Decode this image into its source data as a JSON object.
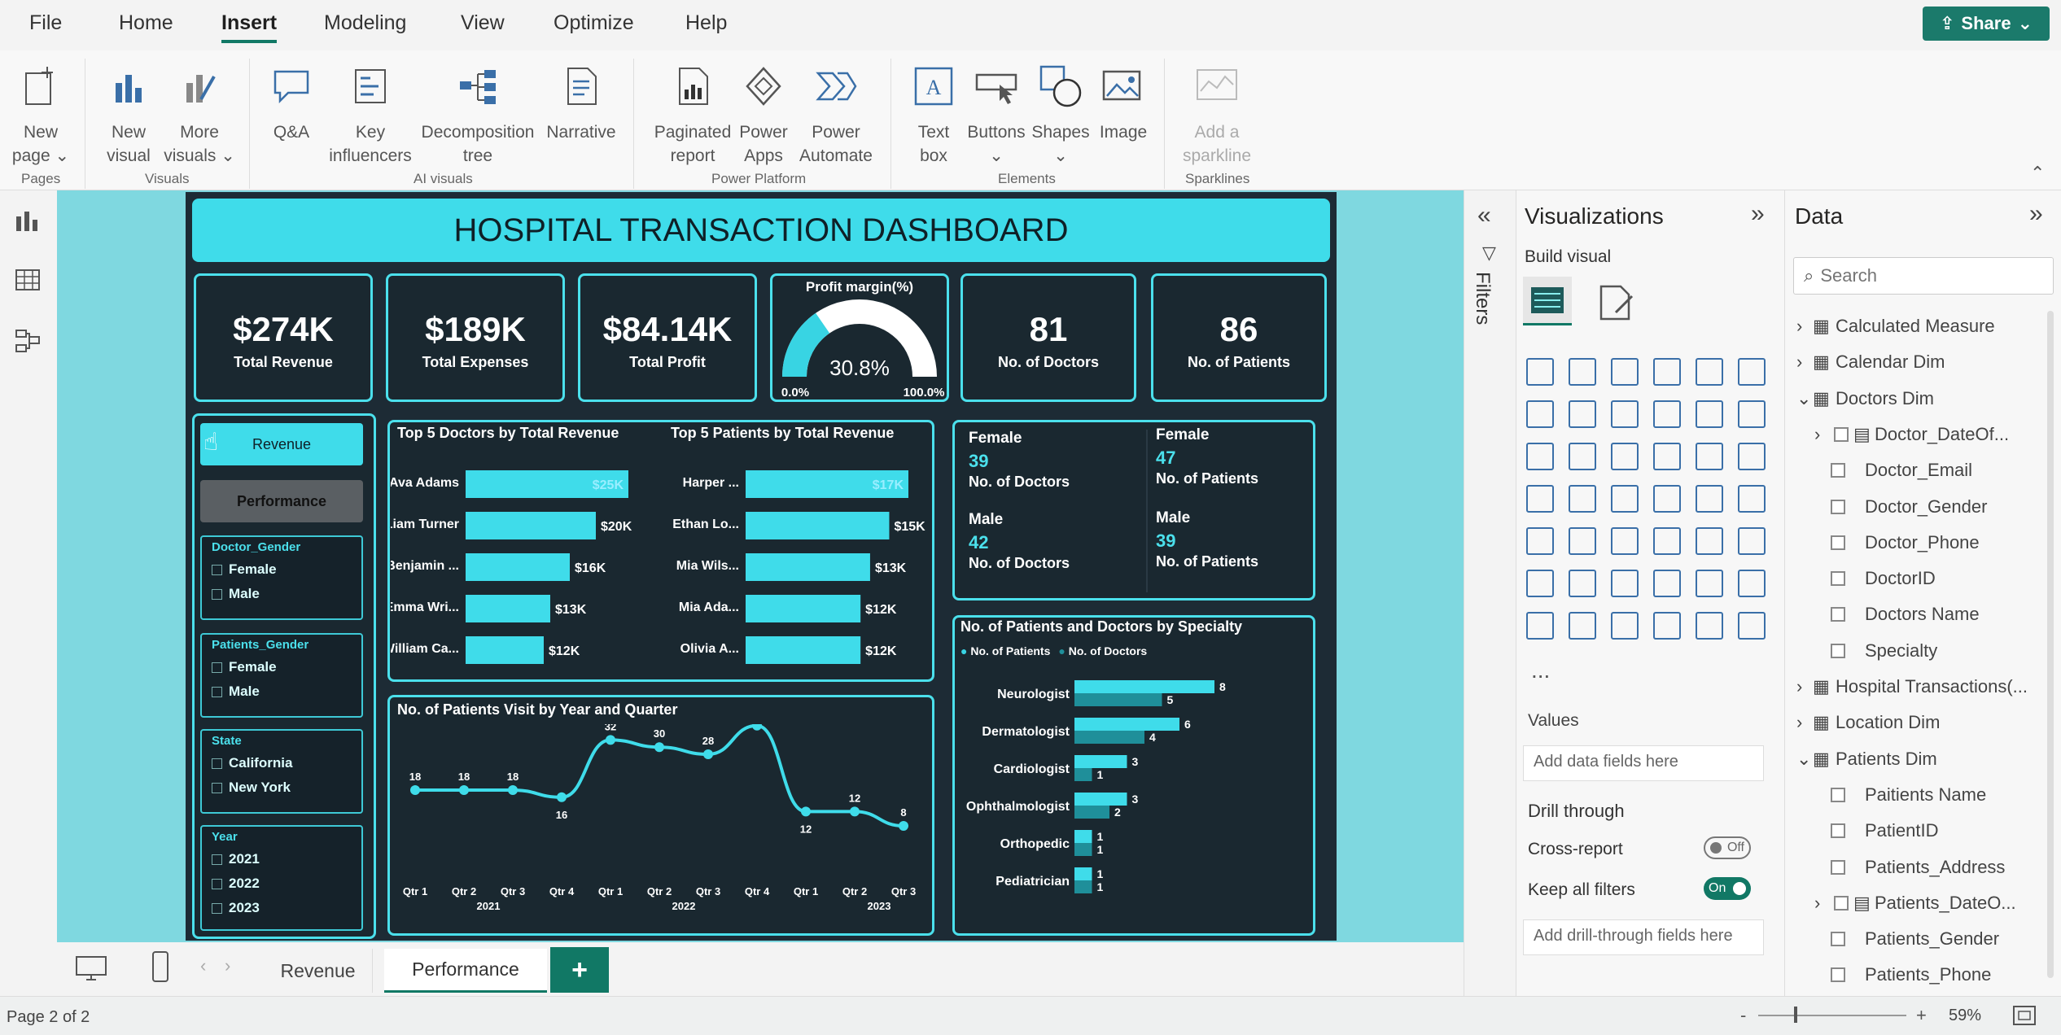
{
  "menu": {
    "items": [
      "File",
      "Home",
      "Insert",
      "Modeling",
      "View",
      "Optimize",
      "Help"
    ],
    "active": "Insert",
    "share": "Share"
  },
  "ribbon": {
    "buttons": [
      {
        "l1": "New",
        "l2": "page ⌄"
      },
      {
        "l1": "New",
        "l2": "visual"
      },
      {
        "l1": "More",
        "l2": "visuals ⌄"
      },
      {
        "l1": "Q&A",
        "l2": ""
      },
      {
        "l1": "Key",
        "l2": "influencers"
      },
      {
        "l1": "Decomposition",
        "l2": "tree"
      },
      {
        "l1": "Narrative",
        "l2": ""
      },
      {
        "l1": "Paginated",
        "l2": "report"
      },
      {
        "l1": "Power",
        "l2": "Apps"
      },
      {
        "l1": "Power",
        "l2": "Automate"
      },
      {
        "l1": "Text",
        "l2": "box"
      },
      {
        "l1": "Buttons",
        "l2": "⌄"
      },
      {
        "l1": "Shapes",
        "l2": "⌄"
      },
      {
        "l1": "Image",
        "l2": ""
      },
      {
        "l1": "Add a",
        "l2": "sparkline"
      }
    ],
    "groups": [
      "Pages",
      "Visuals",
      "AI visuals",
      "Power Platform",
      "Elements",
      "Sparklines"
    ]
  },
  "dashboard": {
    "title": "HOSPITAL TRANSACTION DASHBOARD",
    "kpis": [
      {
        "value": "$274K",
        "label": "Total Revenue"
      },
      {
        "value": "$189K",
        "label": "Total Expenses"
      },
      {
        "value": "$84.14K",
        "label": "Total Profit"
      },
      {
        "value": "81",
        "label": "No. of Doctors"
      },
      {
        "value": "86",
        "label": "No. of Patients"
      }
    ],
    "gauge": {
      "title": "Profit margin(%)",
      "value": "30.8%",
      "min": "0.0%",
      "max": "100.0%",
      "fraction": 0.308
    },
    "nav": {
      "revenue": "Revenue",
      "performance": "Performance"
    },
    "slicers": [
      {
        "title": "Doctor_Gender",
        "options": [
          "Female",
          "Male"
        ]
      },
      {
        "title": "Patients_Gender",
        "options": [
          "Female",
          "Male"
        ]
      },
      {
        "title": "State",
        "options": [
          "California",
          "New York"
        ]
      },
      {
        "title": "Year",
        "options": [
          "2021",
          "2022",
          "2023"
        ]
      }
    ],
    "gender_cards": {
      "female_doctors": {
        "title": "Female",
        "value": "39",
        "label": "No. of Doctors"
      },
      "female_patients": {
        "title": "Female",
        "value": "47",
        "label": "No. of Patients"
      },
      "male_doctors": {
        "title": "Male",
        "value": "42",
        "label": "No. of Doctors"
      },
      "male_patients": {
        "title": "Male",
        "value": "39",
        "label": "No. of Patients"
      }
    }
  },
  "chart_data": [
    {
      "type": "bar",
      "title": "Top 5 Doctors by Total Revenue",
      "categories": [
        "Ava Adams",
        "Liam Turner",
        "Benjamin ...",
        "Emma Wri...",
        "William Ca..."
      ],
      "values": [
        25,
        20,
        16,
        13,
        12
      ],
      "labels": [
        "$25K",
        "$20K",
        "$16K",
        "$13K",
        "$12K"
      ]
    },
    {
      "type": "bar",
      "title": "Top 5 Patients by Total Revenue",
      "categories": [
        "Harper ...",
        "Ethan Lo...",
        "Mia Wils...",
        "Mia Ada...",
        "Olivia A..."
      ],
      "values": [
        17,
        15,
        13,
        12,
        12
      ],
      "labels": [
        "$17K",
        "$15K",
        "$13K",
        "$12K",
        "$12K"
      ]
    },
    {
      "type": "line",
      "title": "No. of Patients Visit by Year and Quarter",
      "categories": [
        "Qtr 1",
        "Qtr 2",
        "Qtr 3",
        "Qtr 4",
        "Qtr 1",
        "Qtr 2",
        "Qtr 3",
        "Qtr 4",
        "Qtr 1",
        "Qtr 2",
        "Qtr 3"
      ],
      "years": [
        "2021",
        "2022",
        "2023"
      ],
      "values": [
        18,
        18,
        18,
        16,
        32,
        30,
        28,
        36,
        12,
        12,
        8
      ]
    },
    {
      "type": "bar",
      "title": "No. of Patients and Doctors by Specialty",
      "categories": [
        "Neurologist",
        "Dermatologist",
        "Cardiologist",
        "Ophthalmologist",
        "Orthopedic",
        "Pediatrician"
      ],
      "series": [
        {
          "name": "No. of Patients",
          "values": [
            8,
            6,
            3,
            3,
            1,
            1
          ]
        },
        {
          "name": "No. of Doctors",
          "values": [
            5,
            4,
            1,
            2,
            1,
            1
          ]
        }
      ],
      "legend": "top-left"
    }
  ],
  "tabs": [
    "Revenue",
    "Performance"
  ],
  "active_tab": "Performance",
  "status": {
    "page": "Page 2 of 2",
    "zoom": "59%"
  },
  "filters_label": "Filters",
  "viz": {
    "title": "Visualizations",
    "build": "Build visual",
    "values": "Values",
    "values_placeholder": "Add data fields here",
    "drill": "Drill through",
    "cross": "Cross-report",
    "cross_state": "Off",
    "keep": "Keep all filters",
    "keep_state": "On",
    "drill_placeholder": "Add drill-through fields here",
    "more": "..."
  },
  "data_pane": {
    "title": "Data",
    "search_placeholder": "Search",
    "items": [
      {
        "label": "Calculated Measure",
        "level": 0,
        "check": false,
        "exp": "›"
      },
      {
        "label": "Calendar Dim",
        "level": 0,
        "check": false,
        "exp": "›"
      },
      {
        "label": "Doctors Dim",
        "level": 0,
        "check": false,
        "exp": "⌄"
      },
      {
        "label": "Doctor_DateOf...",
        "level": 1,
        "check": true,
        "exp": "›"
      },
      {
        "label": "Doctor_Email",
        "level": 2,
        "check": true,
        "exp": ""
      },
      {
        "label": "Doctor_Gender",
        "level": 2,
        "check": true,
        "exp": ""
      },
      {
        "label": "Doctor_Phone",
        "level": 2,
        "check": true,
        "exp": ""
      },
      {
        "label": "DoctorID",
        "level": 2,
        "check": true,
        "exp": ""
      },
      {
        "label": "Doctors Name",
        "level": 2,
        "check": true,
        "exp": ""
      },
      {
        "label": "Specialty",
        "level": 2,
        "check": true,
        "exp": ""
      },
      {
        "label": "Hospital Transactions(...",
        "level": 0,
        "check": false,
        "exp": "›"
      },
      {
        "label": "Location Dim",
        "level": 0,
        "check": false,
        "exp": "›"
      },
      {
        "label": "Patients Dim",
        "level": 0,
        "check": false,
        "exp": "⌄"
      },
      {
        "label": "Paitients Name",
        "level": 2,
        "check": true,
        "exp": ""
      },
      {
        "label": "PatientID",
        "level": 2,
        "check": true,
        "exp": ""
      },
      {
        "label": "Patients_Address",
        "level": 2,
        "check": true,
        "exp": ""
      },
      {
        "label": "Patients_DateO...",
        "level": 1,
        "check": true,
        "exp": "›"
      },
      {
        "label": "Patients_Gender",
        "level": 2,
        "check": true,
        "exp": ""
      },
      {
        "label": "Patients_Phone",
        "level": 2,
        "check": true,
        "exp": ""
      }
    ]
  }
}
